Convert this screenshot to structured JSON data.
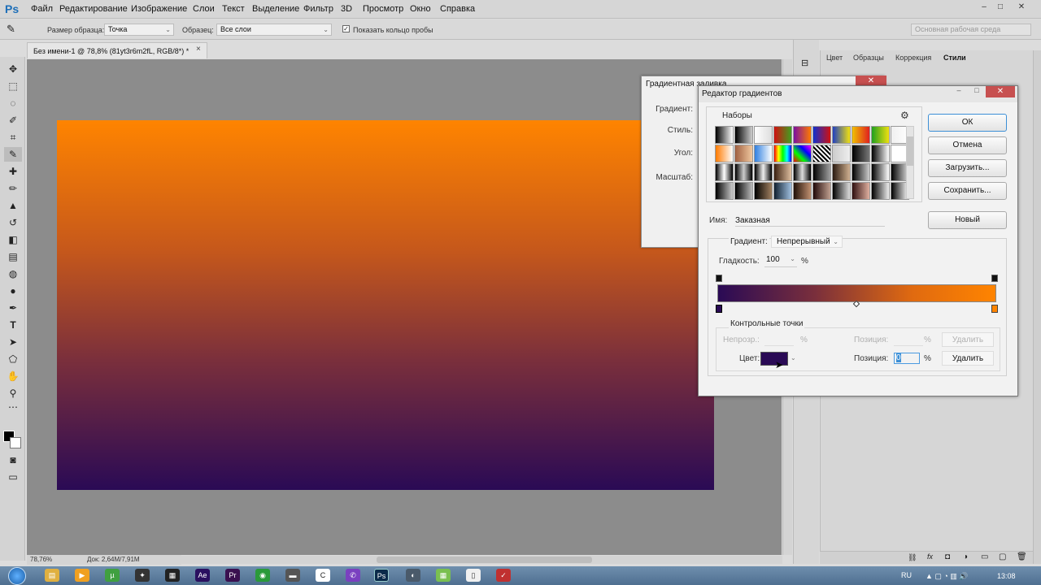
{
  "app": {
    "logo": "Ps",
    "menu": [
      "Файл",
      "Редактирование",
      "Изображение",
      "Слои",
      "Текст",
      "Выделение",
      "Фильтр",
      "3D",
      "Просмотр",
      "Окно",
      "Справка"
    ],
    "window_buttons": [
      "–",
      "□",
      "✕"
    ]
  },
  "options": {
    "sample_size_label": "Размер образца:",
    "sample_size_value": "Точка",
    "sample_label": "Образец:",
    "sample_value": "Все слои",
    "show_ring_label": "Показать кольцо пробы",
    "show_ring_checked": true,
    "workspace_label": "Основная рабочая среда"
  },
  "document": {
    "tab_title": "Без имени-1 @ 78,8% (81yt3r6m2fL, RGB/8*) *",
    "close_glyph": "×",
    "zoom": "78,76%",
    "doc_info": "Док: 2,64M/7,91M"
  },
  "panels": {
    "tabs": [
      "Цвет",
      "Образцы",
      "Коррекция",
      "Стили"
    ],
    "active_tab": "Стили"
  },
  "fill_dialog": {
    "title": "Градиентная заливка",
    "labels": [
      "Градиент:",
      "Стиль:",
      "Угол:",
      "Масштаб:"
    ]
  },
  "gradient_editor": {
    "title": "Редактор градиентов",
    "presets_label": "Наборы",
    "buttons": {
      "ok": "ОК",
      "cancel": "Отмена",
      "load": "Загрузить...",
      "save": "Сохранить...",
      "new": "Новый"
    },
    "name_label": "Имя:",
    "name_value": "Заказная",
    "type_label": "Градиент:",
    "type_value": "Непрерывный",
    "smoothness_label": "Гладкость:",
    "smoothness_value": "100",
    "smoothness_unit": "%",
    "stops_label": "Контрольные точки",
    "opacity_label": "Непрозр.:",
    "opacity_unit": "%",
    "position_label": "Позиция:",
    "position_unit": "%",
    "delete_label": "Удалить",
    "color_label": "Цвет:",
    "color_position_label": "Позиция:",
    "color_position_value": "0",
    "color_position_unit": "%",
    "color_delete_label": "Удалить",
    "gradient_colors": [
      "#2a0a55",
      "#7a2f3c",
      "#e06a10",
      "#ff8400"
    ],
    "stop_color": "#2a0a55"
  },
  "taskbar": {
    "lang": "RU",
    "time": "13:08"
  }
}
